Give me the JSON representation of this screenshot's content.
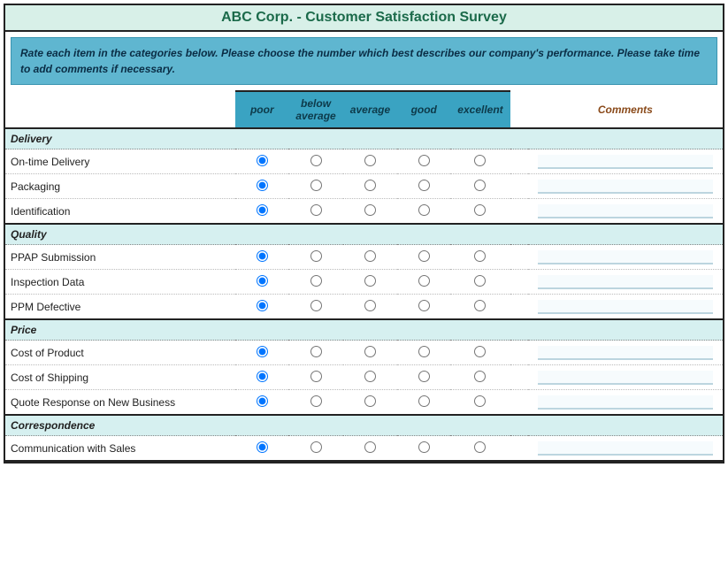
{
  "title": "ABC Corp. - Customer Satisfaction Survey",
  "intro": "Rate each item in the categories below. Please choose the number which best describes our company's performance. Please take time to add comments if necessary.",
  "ratings": [
    "poor",
    "below average",
    "average",
    "good",
    "excellent"
  ],
  "comments_header": "Comments",
  "sections": [
    {
      "name": "Delivery",
      "items": [
        {
          "label": "On-time Delivery",
          "selected": 0,
          "comment": ""
        },
        {
          "label": "Packaging",
          "selected": 0,
          "comment": ""
        },
        {
          "label": "Identification",
          "selected": 0,
          "comment": ""
        }
      ]
    },
    {
      "name": "Quality",
      "items": [
        {
          "label": "PPAP Submission",
          "selected": 0,
          "comment": ""
        },
        {
          "label": "Inspection Data",
          "selected": 0,
          "comment": ""
        },
        {
          "label": "PPM Defective",
          "selected": 0,
          "comment": ""
        }
      ]
    },
    {
      "name": "Price",
      "items": [
        {
          "label": "Cost of Product",
          "selected": 0,
          "comment": ""
        },
        {
          "label": "Cost of Shipping",
          "selected": 0,
          "comment": ""
        },
        {
          "label": "Quote Response on New Business",
          "selected": 0,
          "comment": ""
        }
      ]
    },
    {
      "name": "Correspondence",
      "items": [
        {
          "label": "Communication with Sales",
          "selected": 0,
          "comment": ""
        }
      ]
    }
  ]
}
